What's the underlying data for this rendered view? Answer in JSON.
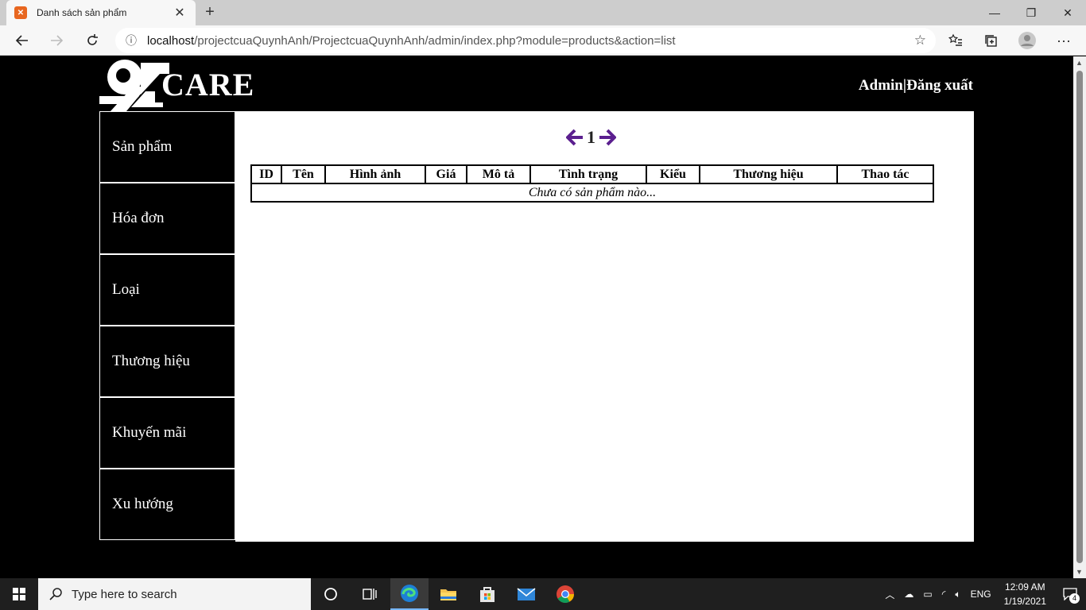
{
  "browser": {
    "tab_title": "Danh sách sản phẩm",
    "tab_favicon": "xampp-icon",
    "url_host": "localhost",
    "url_path": "/projectcuaQuynhAnh/ProjectcuaQuynhAnh/admin/index.php?module=products&action=list"
  },
  "header": {
    "logo_text": "94CARE",
    "admin_label": "Admin",
    "separator": "|",
    "logout_label": "Đăng xuất"
  },
  "sidebar": {
    "items": [
      {
        "label": "Sản phẩm"
      },
      {
        "label": "Hóa đơn"
      },
      {
        "label": "Loại"
      },
      {
        "label": "Thương hiệu"
      },
      {
        "label": "Khuyến mãi"
      },
      {
        "label": "Xu hướng"
      }
    ]
  },
  "pager": {
    "current_page": "1",
    "arrow_color": "#5b1f8f"
  },
  "table": {
    "headers": [
      "ID",
      "Tên",
      "Hình ảnh",
      "Giá",
      "Mô tả",
      "Tình trạng",
      "Kiểu",
      "Thương hiệu",
      "Thao tác"
    ],
    "empty_message": "Chưa có sản phẩm nào..."
  },
  "taskbar": {
    "search_placeholder": "Type here to search",
    "language": "ENG",
    "time": "12:09 AM",
    "date": "1/19/2021",
    "notification_count": "4"
  }
}
